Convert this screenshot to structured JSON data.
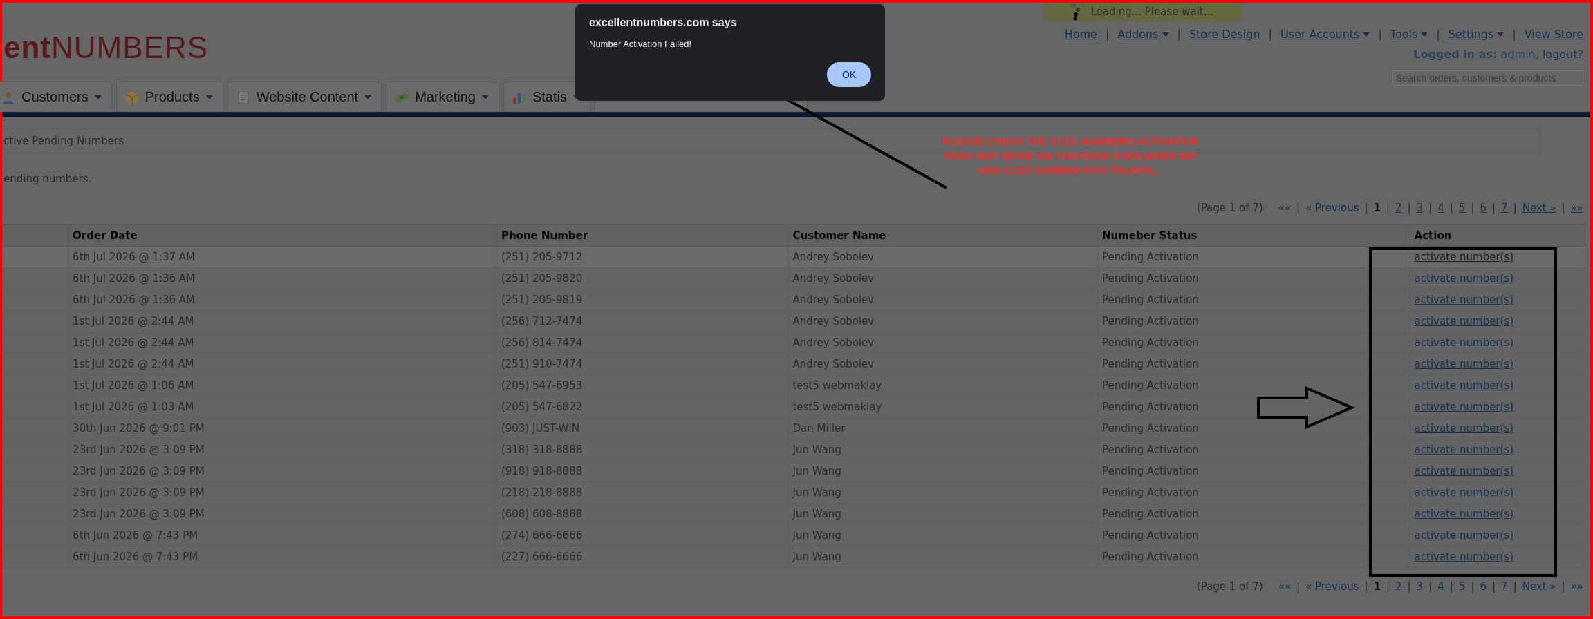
{
  "logo": "**ent**NUMBERS",
  "loading": "Loading... Please wait...",
  "nav": {
    "separator": "|",
    "links": [
      {
        "label": "Home",
        "dropdown": false
      },
      {
        "label": "Addons",
        "dropdown": true
      },
      {
        "label": "Store Design",
        "dropdown": false
      },
      {
        "label": "User Accounts",
        "dropdown": true
      },
      {
        "label": "Tools",
        "dropdown": true
      },
      {
        "label": "Settings",
        "dropdown": true
      },
      {
        "label": "View Store",
        "dropdown": false
      }
    ]
  },
  "login": {
    "text": "**Logged in as:** admin,",
    "link": "logout?"
  },
  "search": {
    "placeholder": "Search orders, customers & products"
  },
  "tabs": [
    {
      "label": "Customers"
    },
    {
      "label": "Products"
    },
    {
      "label": "Website Content"
    },
    {
      "label": "Marketing"
    },
    {
      "label": "Statis"
    }
  ],
  "breadcrumb": "ctive Pending Numbers",
  "info": "ending numbers.",
  "pagination_top": {
    "summary": "(Page 1 of 7)",
    "first": "««",
    "prev": "« Previous",
    "separator": "|",
    "pages": [
      {
        "label": "1",
        "selected": true
      },
      {
        "label": "2",
        "selected": false
      },
      {
        "label": "3",
        "selected": false
      },
      {
        "label": "4",
        "selected": false
      },
      {
        "label": "5",
        "selected": false
      },
      {
        "label": "6",
        "selected": false
      },
      {
        "label": "7",
        "selected": false
      }
    ],
    "next": "Next »",
    "last": "»»"
  },
  "table": {
    "columns": [
      "Order Date",
      "Phone Number",
      "Customer Name",
      "Numeber Status",
      "Action"
    ],
    "rows": [
      {
        "date": "6th Jul 2026 @ 1:37 AM",
        "phone": "(251) 205-9712",
        "customer": "Andrey Sobolev",
        "status": "Pending Activation",
        "action": "activate number(s)",
        "highlighted": true
      },
      {
        "date": "6th Jul 2026 @ 1:36 AM",
        "phone": "(251) 205-9820",
        "customer": "Andrey Sobolev",
        "status": "Pending Activation",
        "action": "activate number(s)",
        "highlighted": false
      },
      {
        "date": "6th Jul 2026 @ 1:36 AM",
        "phone": "(251) 205-9819",
        "customer": "Andrey Sobolev",
        "status": "Pending Activation",
        "action": "activate number(s)",
        "highlighted": false
      },
      {
        "date": "1st Jul 2026 @ 2:44 AM",
        "phone": "(256) 712-7474",
        "customer": "Andrey Sobolev",
        "status": "Pending Activation",
        "action": "activate number(s)",
        "highlighted": false
      },
      {
        "date": "1st Jul 2026 @ 2:44 AM",
        "phone": "(256) 814-7474",
        "customer": "Andrey Sobolev",
        "status": "Pending Activation",
        "action": "activate number(s)",
        "highlighted": false
      },
      {
        "date": "1st Jul 2026 @ 2:44 AM",
        "phone": "(251) 910-7474",
        "customer": "Andrey Sobolev",
        "status": "Pending Activation",
        "action": "activate number(s)",
        "highlighted": false
      },
      {
        "date": "1st Jul 2026 @ 1:06 AM",
        "phone": "(205) 547-6953",
        "customer": "test5 webmaklay",
        "status": "Pending Activation",
        "action": "activate number(s)",
        "highlighted": false
      },
      {
        "date": "1st Jul 2026 @ 1:03 AM",
        "phone": "(205) 547-6822",
        "customer": "test5 webmaklay",
        "status": "Pending Activation",
        "action": "activate number(s)",
        "highlighted": false
      },
      {
        "date": "30th Jun 2026 @ 9:01 PM",
        "phone": "(903) JUST-WIN",
        "customer": "Dan Miller",
        "status": "Pending Activation",
        "action": "activate number(s)",
        "highlighted": false
      },
      {
        "date": "23rd Jun 2026 @ 3:09 PM",
        "phone": "(318) 318-8888",
        "customer": "Jun Wang",
        "status": "Pending Activation",
        "action": "activate number(s)",
        "highlighted": false
      },
      {
        "date": "23rd Jun 2026 @ 3:09 PM",
        "phone": "(918) 918-8888",
        "customer": "Jun Wang",
        "status": "Pending Activation",
        "action": "activate number(s)",
        "highlighted": false
      },
      {
        "date": "23rd Jun 2026 @ 3:09 PM",
        "phone": "(218) 218-8888",
        "customer": "Jun Wang",
        "status": "Pending Activation",
        "action": "activate number(s)",
        "highlighted": false
      },
      {
        "date": "23rd Jun 2026 @ 3:09 PM",
        "phone": "(608) 608-8888",
        "customer": "Jun Wang",
        "status": "Pending Activation",
        "action": "activate number(s)",
        "highlighted": false
      },
      {
        "date": "6th Jun 2026 @ 7:43 PM",
        "phone": "(274) 666-6666",
        "customer": "Jun Wang",
        "status": "Pending Activation",
        "action": "activate number(s)",
        "highlighted": false
      },
      {
        "date": "6th Jun 2026 @ 7:43 PM",
        "phone": "(227) 666-6666",
        "customer": "Jun Wang",
        "status": "Pending Activation",
        "action": "activate number(s)",
        "highlighted": false
      }
    ]
  },
  "pagination_bottom": {
    "summary": "(Page 1 of 7)",
    "first": "««",
    "prev": "« Previous",
    "separator": "|",
    "pages": [
      {
        "label": "1",
        "selected": true
      },
      {
        "label": "2",
        "selected": false
      },
      {
        "label": "3",
        "selected": false
      },
      {
        "label": "4",
        "selected": false
      },
      {
        "label": "5",
        "selected": false
      },
      {
        "label": "6",
        "selected": false
      },
      {
        "label": "7",
        "selected": false
      }
    ],
    "next": "Next »",
    "last": "»»"
  },
  "dialog": {
    "title": "excellentnumbers.com says",
    "message": "Number Activation Failed!",
    "button": "OK"
  },
  "annotation": "PLEASE CHECK THE CLEC NUMBERS ACTIVATION DOES NOT WORK ON THIS PAGE EVEN WHEN WE ADD CLEC NUMBER INTO TELINTA..."
}
